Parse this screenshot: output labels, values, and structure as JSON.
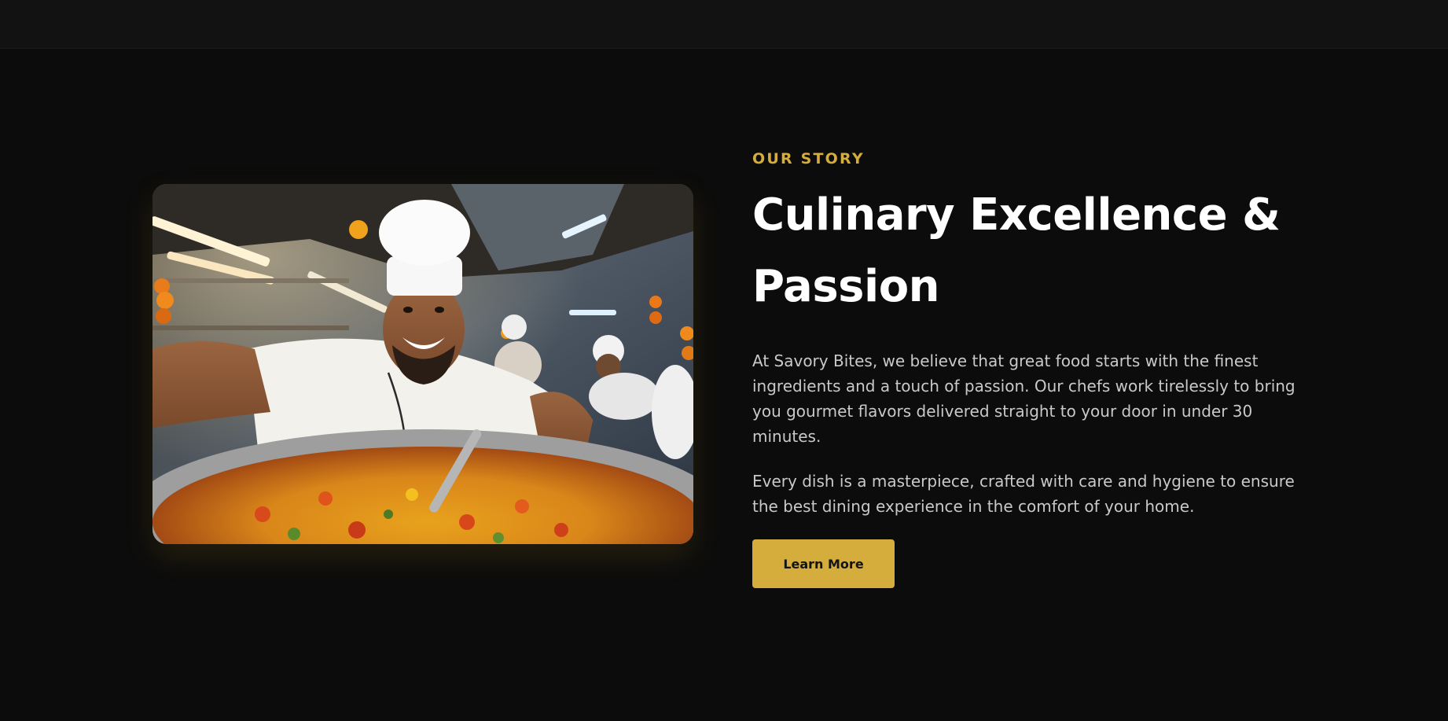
{
  "story": {
    "eyebrow": "OUR STORY",
    "headline": "Culinary Excellence & Passion",
    "paragraphs": [
      "At Savory Bites, we believe that great food starts with the finest ingredients and a touch of passion. Our chefs work tirelessly to bring you gourmet flavors delivered straight to your door in under 30 minutes.",
      "Every dish is a masterpiece, crafted with care and hygiene to ensure the best dining experience in the comfort of your home."
    ],
    "cta_label": "Learn More"
  },
  "colors": {
    "accent": "#d4ad3d",
    "background": "#0c0c0c",
    "topbar": "#121212",
    "heading": "#ffffff",
    "body_text": "#c9c9c9"
  }
}
